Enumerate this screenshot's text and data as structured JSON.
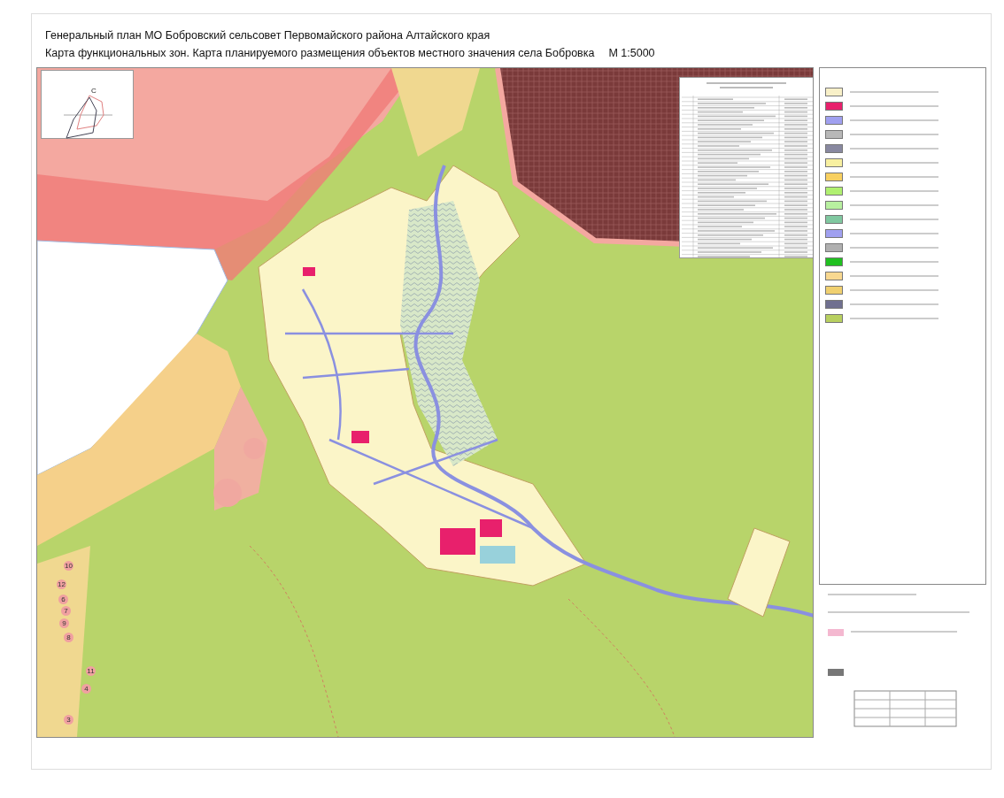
{
  "title": {
    "line_1": "Генеральный план МО Бобровский сельсовет Первомайского района Алтайского края",
    "line_2": "Карта функциональных зон. Карта планируемого размещения объектов местного значения села Бобровка",
    "scale": "М 1:5000"
  },
  "wind_rose": {
    "north_label": "С"
  },
  "map": {
    "labels": [
      "10",
      "12",
      "6",
      "7",
      "9",
      "8",
      "11",
      "4",
      "3"
    ]
  },
  "legend": {
    "swatches": [
      {
        "color": "#f8f0c8"
      },
      {
        "color": "#e8206c"
      },
      {
        "color": "#a0a0f0"
      },
      {
        "color": "#b8b8b8"
      },
      {
        "color": "#8888a0"
      },
      {
        "color": "#f8f0a0"
      },
      {
        "color": "#f8d060"
      },
      {
        "color": "#b0f070"
      },
      {
        "color": "#b8f0a0"
      },
      {
        "color": "#80c8a0"
      },
      {
        "color": "#a0a0f0"
      },
      {
        "color": "#b0b0b0"
      },
      {
        "color": "#20c020"
      },
      {
        "color": "#f8d890"
      },
      {
        "color": "#f0d070"
      },
      {
        "color": "#707090"
      },
      {
        "color": "#b8d060"
      }
    ]
  }
}
